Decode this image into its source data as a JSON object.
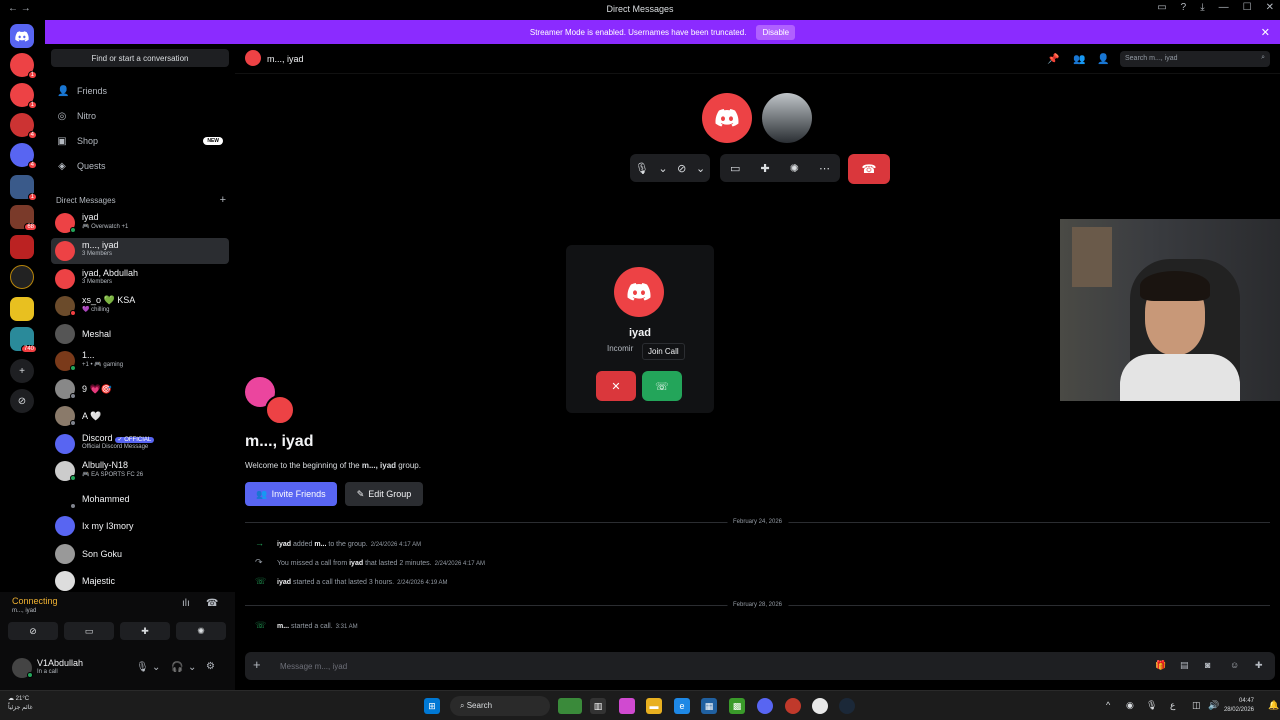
{
  "window": {
    "title": "Direct Messages"
  },
  "banner": {
    "text": "Streamer Mode is enabled. Usernames have been truncated.",
    "button": "Disable"
  },
  "sidebar": {
    "find_button": "Find or start a conversation",
    "nav": [
      {
        "label": "Friends",
        "icon": "friends-icon"
      },
      {
        "label": "Nitro",
        "icon": "nitro-icon"
      },
      {
        "label": "Shop",
        "icon": "shop-icon",
        "badge": "NEW"
      },
      {
        "label": "Quests",
        "icon": "quests-icon"
      }
    ],
    "dm_header": "Direct Messages",
    "dms": [
      {
        "name": "iyad",
        "sub": "🎮 Overwatch +1",
        "color": "#ed4245",
        "status": "#23a55a"
      },
      {
        "name": "m..., iyad",
        "sub": "3 Members",
        "color": "#ed4245",
        "selected": true
      },
      {
        "name": "iyad, Abdullah",
        "sub": "3 Members",
        "color": "#ed4245"
      },
      {
        "name": "xs_o 💚 KSA",
        "sub": "💜 chilling",
        "color": "#6b4b2b",
        "status": "#f23f42"
      },
      {
        "name": "Meshal",
        "sub": "",
        "color": "#555"
      },
      {
        "name": "1...",
        "sub": "+1 • 🎮 gaming",
        "color": "#7a3a1a",
        "status": "#23a55a"
      },
      {
        "name": "9 💗🎯",
        "sub": "",
        "color": "#888",
        "status": "#80848e"
      },
      {
        "name": "A 🤍",
        "sub": "",
        "color": "#8a7a6a",
        "status": "#80848e"
      },
      {
        "name": "Discord",
        "sub": "Official Discord Message",
        "color": "#5865f2",
        "official": "✓ OFFICIAL"
      },
      {
        "name": "Albully-N18",
        "sub": "🎮 EA SPORTS FC 26",
        "color": "#ccc",
        "status": "#23a55a"
      },
      {
        "name": "Mohammed",
        "sub": "",
        "color": "#000",
        "status": "#80848e"
      },
      {
        "name": "Ix my I3mory",
        "sub": "",
        "color": "#5865f2"
      },
      {
        "name": "Son Goku",
        "sub": "",
        "color": "#999"
      },
      {
        "name": "Majestic",
        "sub": "",
        "color": "#ddd"
      }
    ]
  },
  "user_panel": {
    "connecting": "Connecting",
    "channel": "m..., iyad",
    "username": "V1Abdullah",
    "status": "In a call"
  },
  "header": {
    "title": "m..., iyad",
    "search_placeholder": "Search m..., iyad"
  },
  "incoming": {
    "name": "iyad",
    "status": "Incomir",
    "tooltip": "Join Call"
  },
  "group": {
    "title": "m..., iyad",
    "welcome_prefix": "Welcome to the beginning of the ",
    "welcome_name": "m..., iyad",
    "welcome_suffix": " group.",
    "invite": "Invite Friends",
    "edit": "Edit Group"
  },
  "messages": {
    "date1": "February 24, 2026",
    "date2": "February 28, 2026",
    "m1": {
      "user": "iyad",
      "text": " added ",
      "target": "m...",
      "rest": " to the group.",
      "ts": "2/24/2026 4:17 AM"
    },
    "m2": {
      "pre": "You missed a call from ",
      "user": "iyad",
      "rest": " that lasted 2 minutes.",
      "ts": "2/24/2026 4:17 AM"
    },
    "m3": {
      "user": "iyad",
      "rest": " started a call that lasted 3 hours.",
      "ts": "2/24/2026 4:19 AM"
    },
    "m4": {
      "user": "m...",
      "rest": " started a call.",
      "ts": "3:31 AM"
    }
  },
  "composer": {
    "placeholder": "Message m..., iyad"
  },
  "taskbar": {
    "weather_temp": "21°C",
    "weather_desc": "غائم جزئياً",
    "search": "Search",
    "time": "04:47",
    "date": "28/02/2026"
  },
  "colors": {
    "brand": "#5865f2",
    "banner": "#8b2bff",
    "danger": "#da373c",
    "success": "#23a55a"
  }
}
